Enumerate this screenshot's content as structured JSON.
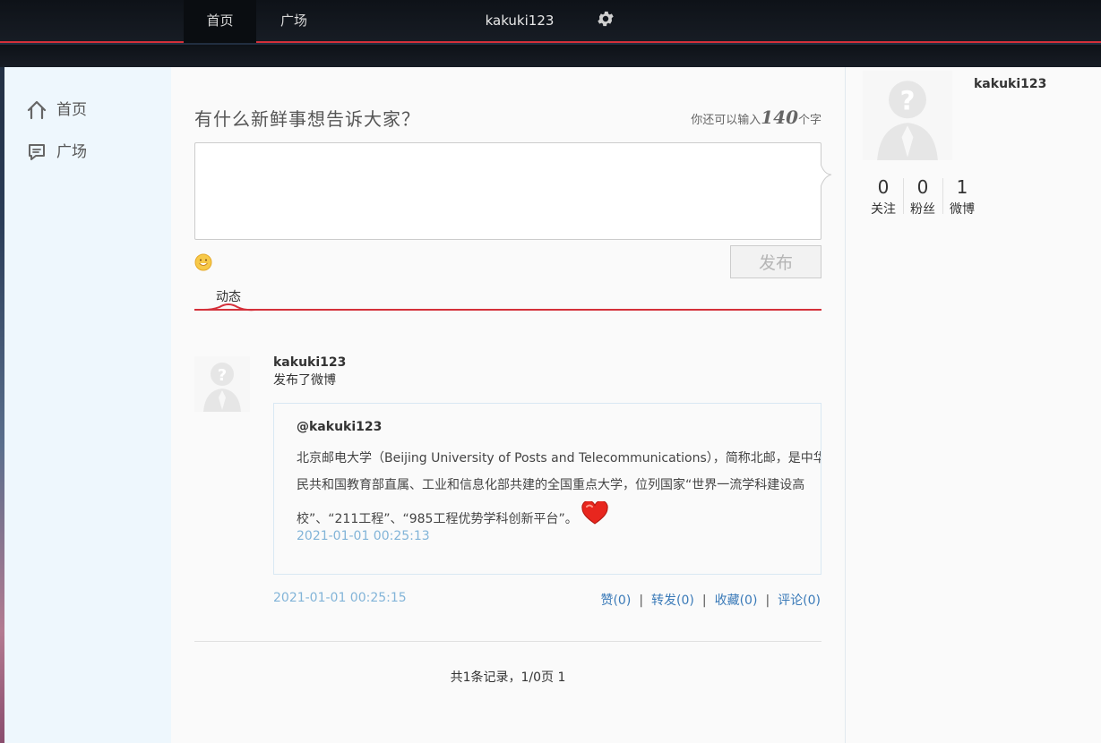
{
  "nav": {
    "home": "首页",
    "square": "广场",
    "username": "kakuki123"
  },
  "sidebar": {
    "items": [
      {
        "label": "首页",
        "icon": "home-icon"
      },
      {
        "label": "广场",
        "icon": "chat-icon"
      }
    ]
  },
  "composer": {
    "title": "有什么新鲜事想告诉大家？",
    "counter_prefix": "你还可以输入",
    "counter_value": "140",
    "counter_suffix": "个字",
    "value": "",
    "publish_label": "发布"
  },
  "tabs": {
    "dynamic": "动态"
  },
  "feed": {
    "items": [
      {
        "user": "kakuki123",
        "action": "发布了微博",
        "quote_user": "@kakuki123",
        "quote_lines": [
          "北京邮电大学（Beijing University of Posts and Telecommunications），简称北邮，是中华人",
          "民共和国教育部直属、工业和信息化部共建的全国重点大学，位列国家“世界一流学科建设高",
          "校”、“211工程”、“985工程优势学科创新平台”。"
        ],
        "quote_time": "2021-01-01 00:25:13",
        "time": "2021-01-01 00:25:15",
        "actions": {
          "like": "赞(0)",
          "repost": "转发(0)",
          "favorite": "收藏(0)",
          "comment": "评论(0)"
        }
      }
    ],
    "pager": "共1条记录，1/0页 1"
  },
  "profile": {
    "name": "kakuki123",
    "stats": [
      {
        "value": "0",
        "label": "关注"
      },
      {
        "value": "0",
        "label": "粉丝"
      },
      {
        "value": "1",
        "label": "微博"
      }
    ]
  },
  "colors": {
    "accent_red": "#d4303a",
    "link_blue": "#3a7ab8",
    "time_blue": "#82b4d8"
  }
}
